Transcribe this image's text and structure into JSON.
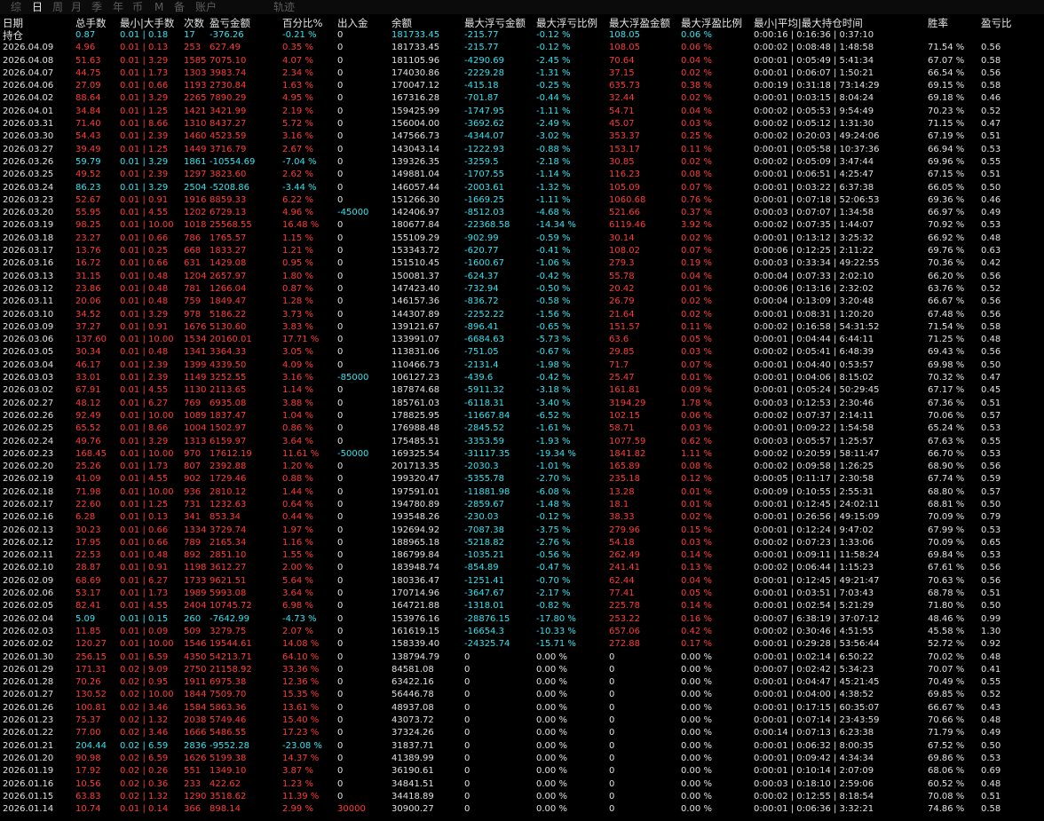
{
  "tabs": [
    "综",
    "日",
    "周",
    "月",
    "季",
    "年",
    "币",
    "M",
    "备",
    "账户",
    "轨迹"
  ],
  "active_tab": 1,
  "header": {
    "top": [
      "日期",
      "总手数",
      "最小|大手数",
      "次数",
      "盈亏金额",
      "百分比%",
      "出入金",
      "余额",
      "最大浮亏金额",
      "最大浮亏比例",
      "最大浮盈金额",
      "最大浮盈比例",
      "最小|平均|最大持仓时间",
      "胜率",
      "盈亏比"
    ],
    "second": "持仓",
    "position": [
      "0.87",
      "0.01 | 0.18",
      "17",
      "-376.26",
      "-0.21 %",
      "0",
      "181733.45",
      "-215.77",
      "-0.12 %",
      "108.05",
      "0.06 %",
      "0:00:16 | 0:16:36 | 0:37:10"
    ]
  },
  "colors": {
    "profit": "#ff3a3a",
    "loss": "#2fe4f0",
    "text": "#e0e0e0",
    "background": "#000000"
  },
  "rows": [
    "2026.04.09|4.96|0.01 | 0.13|253|627.49|0.35 %|0|181733.45|-215.77|-0.12 %|108.05|0.06 %|0:00:02 | 0:08:48 | 1:48:58|71.54 %|0.56|r|",
    "2026.04.08|51.63|0.01 | 3.29|1585|7075.10|4.07 %|0|181105.96|-4290.69|-2.45 %|70.64|0.04 %|0:00:01 | 0:05:49 | 5:41:34|67.07 %|0.58|r|",
    "2026.04.07|44.75|0.01 | 1.73|1303|3983.74|2.34 %|0|174030.86|-2229.28|-1.31 %|37.15|0.02 %|0:00:01 | 0:06:07 | 1:50:21|66.54 %|0.56|r|",
    "2026.04.06|27.09|0.01 | 0.66|1193|2730.84|1.63 %|0|170047.12|-415.18|-0.25 %|635.73|0.38 %|0:00:19 | 0:31:18 | 73:14:29|69.15 %|0.58|r|",
    "2026.04.02|88.64|0.01 | 3.29|2265|7890.29|4.95 %|0|167316.28|-701.87|-0.44 %|32.44|0.02 %|0:00:01 | 0:03:15 | 8:04:24|69.18 %|0.46|r|",
    "2026.04.01|34.84|0.01 | 1.25|1421|3421.99|2.19 %|0|159425.99|-1747.95|-1.11 %|54.71|0.04 %|0:00:02 | 0:05:53 | 9:54:49|70.23 %|0.52|r|",
    "2026.03.31|71.40|0.01 | 8.66|1310|8437.27|5.72 %|0|156004.00|-3692.62|-2.49 %|45.07|0.03 %|0:00:02 | 0:05:12 | 1:31:30|71.15 %|0.47|r|",
    "2026.03.30|54.43|0.01 | 2.39|1460|4523.59|3.16 %|0|147566.73|-4344.07|-3.02 %|353.37|0.25 %|0:00:02 | 0:20:03 | 49:24:06|67.19 %|0.51|r|",
    "2026.03.27|39.49|0.01 | 1.25|1449|3716.79|2.67 %|0|143043.14|-1222.93|-0.88 %|153.17|0.11 %|0:00:01 | 0:05:58 | 10:37:36|66.94 %|0.53|r|",
    "2026.03.26|59.79|0.01 | 3.29|1861|-10554.69|-7.04 %|0|139326.35|-3259.5|-2.18 %|30.85|0.02 %|0:00:02 | 0:05:09 | 3:47:44|69.96 %|0.55|g|",
    "2026.03.25|49.52|0.01 | 2.39|1297|3823.60|2.62 %|0|149881.04|-1707.55|-1.14 %|116.23|0.08 %|0:00:01 | 0:06:51 | 4:25:47|67.15 %|0.51|r|",
    "2026.03.24|86.23|0.01 | 3.29|2504|-5208.86|-3.44 %|0|146057.44|-2003.61|-1.32 %|105.09|0.07 %|0:00:01 | 0:03:22 | 6:37:38|66.05 %|0.50|g|",
    "2026.03.23|52.67|0.01 | 0.91|1916|8859.33|6.22 %|0|151266.30|-1669.25|-1.11 %|1060.68|0.76 %|0:00:01 | 0:07:18 | 52:06:53|69.36 %|0.46|r|",
    "2026.03.20|55.95|0.01 | 4.55|1202|6729.13|4.96 %|-45000|142406.97|-8512.03|-4.68 %|521.66|0.37 %|0:00:03 | 0:07:07 | 1:34:58|66.97 %|0.49|r|cy",
    "2026.03.19|98.25|0.01 | 10.00|1018|25568.55|16.48 %|0|180677.84|-22368.58|-14.34 %|6119.46|3.92 %|0:00:02 | 0:07:35 | 1:44:07|70.92 %|0.53|r|",
    "2026.03.18|23.27|0.01 | 0.66|786|1765.57|1.15 %|0|155109.29|-902.99|-0.59 %|30.14|0.02 %|0:00:01 | 0:13:12 | 3:25:32|66.92 %|0.48|r|",
    "2026.03.17|13.76|0.01 | 0.25|668|1833.27|1.21 %|0|153343.72|-620.77|-0.41 %|108.02|0.07 %|0:00:06 | 0:12:25 | 2:11:22|69.76 %|0.63|r|",
    "2026.03.16|16.72|0.01 | 0.66|631|1429.08|0.95 %|0|151510.45|-1600.67|-1.06 %|279.3|0.19 %|0:00:03 | 0:33:34 | 49:22:55|70.36 %|0.42|r|",
    "2026.03.13|31.15|0.01 | 0.48|1204|2657.97|1.80 %|0|150081.37|-624.37|-0.42 %|55.78|0.04 %|0:00:04 | 0:07:33 | 2:02:10|66.20 %|0.56|r|",
    "2026.03.12|23.86|0.01 | 0.48|781|1266.04|0.87 %|0|147423.40|-732.94|-0.50 %|20.42|0.01 %|0:00:06 | 0:13:16 | 2:32:02|63.76 %|0.52|r|",
    "2026.03.11|20.06|0.01 | 0.48|759|1849.47|1.28 %|0|146157.36|-836.72|-0.58 %|26.79|0.02 %|0:00:04 | 0:13:09 | 3:20:48|66.67 %|0.56|r|",
    "2026.03.10|34.52|0.01 | 3.29|978|5186.22|3.73 %|0|144307.89|-2252.22|-1.56 %|21.64|0.02 %|0:00:01 | 0:08:31 | 1:20:20|67.48 %|0.56|r|",
    "2026.03.09|37.27|0.01 | 0.91|1676|5130.60|3.83 %|0|139121.67|-896.41|-0.65 %|151.57|0.11 %|0:00:02 | 0:16:58 | 54:31:52|71.54 %|0.58|r|",
    "2026.03.06|137.60|0.01 | 10.00|1534|20160.01|17.71 %|0|133991.07|-6684.63|-5.73 %|63.6|0.05 %|0:00:01 | 0:04:44 | 6:44:11|71.25 %|0.48|r|",
    "2026.03.05|30.34|0.01 | 0.48|1341|3364.33|3.05 %|0|113831.06|-751.05|-0.67 %|29.85|0.03 %|0:00:02 | 0:05:41 | 6:48:39|69.43 %|0.56|r|",
    "2026.03.04|46.17|0.01 | 2.39|1399|4339.50|4.09 %|0|110466.73|-2131.4|-1.98 %|71.7|0.07 %|0:00:01 | 0:04:40 | 0:53:57|69.98 %|0.50|r|",
    "2026.03.03|33.01|0.01 | 2.39|1149|3252.55|3.16 %|-85000|106127.23|-439.6|-0.42 %|25.47|0.01 %|0:00:01 | 0:04:06 | 8:15:02|70.32 %|0.47|r|cy",
    "2026.03.02|67.91|0.01 | 4.55|1130|2113.65|1.14 %|0|187874.68|-5911.32|-3.18 %|161.81|0.09 %|0:00:01 | 0:05:24 | 50:29:45|67.17 %|0.45|r|",
    "2026.02.27|48.12|0.01 | 6.27|769|6935.08|3.88 %|0|185761.03|-6118.31|-3.40 %|3194.29|1.78 %|0:00:03 | 0:12:53 | 2:30:46|67.36 %|0.51|r|",
    "2026.02.26|92.49|0.01 | 10.00|1089|1837.47|1.04 %|0|178825.95|-11667.84|-6.52 %|102.15|0.06 %|0:00:02 | 0:07:37 | 2:14:11|70.06 %|0.57|r|",
    "2026.02.25|65.52|0.01 | 8.66|1004|1502.97|0.86 %|0|176988.48|-2845.52|-1.61 %|58.71|0.03 %|0:00:01 | 0:09:22 | 1:54:58|65.24 %|0.53|r|",
    "2026.02.24|49.76|0.01 | 3.29|1313|6159.97|3.64 %|0|175485.51|-3353.59|-1.93 %|1077.59|0.62 %|0:00:03 | 0:05:57 | 1:25:57|67.63 %|0.55|r|",
    "2026.02.23|168.45|0.01 | 10.00|970|17612.19|11.61 %|-50000|169325.54|-31117.35|-19.34 %|1841.82|1.11 %|0:00:02 | 0:20:59 | 58:11:47|66.70 %|0.53|r|cy",
    "2026.02.20|25.26|0.01 | 1.73|807|2392.88|1.20 %|0|201713.35|-2030.3|-1.01 %|165.89|0.08 %|0:00:02 | 0:09:58 | 1:26:25|68.90 %|0.56|r|",
    "2026.02.19|41.09|0.01 | 4.55|902|1729.46|0.88 %|0|199320.47|-5355.78|-2.70 %|235.18|0.12 %|0:00:05 | 0:11:17 | 2:30:58|67.74 %|0.59|r|",
    "2026.02.18|71.98|0.01 | 10.00|936|2810.12|1.44 %|0|197591.01|-11881.98|-6.08 %|13.28|0.01 %|0:00:09 | 0:10:55 | 2:55:31|68.80 %|0.57|r|",
    "2026.02.17|22.60|0.01 | 1.25|731|1232.63|0.64 %|0|194780.89|-2859.67|-1.48 %|18.1|0.01 %|0:00:01 | 0:12:45 | 24:02:11|68.81 %|0.50|r|",
    "2026.02.16|6.28|0.01 | 0.13|341|853.34|0.44 %|0|193548.26|-230.03|-0.12 %|38.33|0.02 %|0:00:01 | 0:26:56 | 49:15:09|70.09 %|0.79|r|",
    "2026.02.13|30.23|0.01 | 0.66|1334|3729.74|1.97 %|0|192694.92|-7087.38|-3.75 %|279.96|0.15 %|0:00:01 | 0:12:24 | 9:47:02|67.99 %|0.53|r|",
    "2026.02.12|17.95|0.01 | 0.66|789|2165.34|1.16 %|0|188965.18|-5218.82|-2.76 %|54.18|0.03 %|0:00:02 | 0:07:23 | 1:33:06|70.09 %|0.65|r|",
    "2026.02.11|22.53|0.01 | 0.48|892|2851.10|1.55 %|0|186799.84|-1035.21|-0.56 %|262.49|0.14 %|0:00:01 | 0:09:11 | 11:58:24|69.84 %|0.53|r|",
    "2026.02.10|28.87|0.01 | 0.91|1198|3612.27|2.00 %|0|183948.74|-854.89|-0.47 %|241.41|0.13 %|0:00:02 | 0:06:44 | 1:15:23|67.61 %|0.56|r|",
    "2026.02.09|68.69|0.01 | 6.27|1733|9621.51|5.64 %|0|180336.47|-1251.41|-0.70 %|62.44|0.04 %|0:00:01 | 0:12:45 | 49:21:47|70.63 %|0.56|r|",
    "2026.02.06|53.17|0.01 | 1.73|1989|5993.08|3.64 %|0|170714.96|-3647.67|-2.17 %|77.41|0.05 %|0:00:01 | 0:03:51 | 7:03:43|68.78 %|0.51|r|",
    "2026.02.05|82.41|0.01 | 4.55|2404|10745.72|6.98 %|0|164721.88|-1318.01|-0.82 %|225.78|0.14 %|0:00:01 | 0:02:54 | 5:21:29|71.80 %|0.50|r|",
    "2026.02.04|5.09|0.01 | 0.15|260|-7642.99|-4.73 %|0|153976.16|-28876.15|-17.80 %|253.22|0.16 %|0:00:07 | 6:38:19 | 37:07:12|48.46 %|0.99|g|",
    "2026.02.03|11.85|0.01 | 0.09|509|3279.75|2.07 %|0|161619.15|-16654.3|-10.33 %|657.06|0.42 %|0:00:02 | 0:30:46 | 4:51:55|45.58 %|1.30|r|",
    "2026.02.02|120.27|0.01 | 10.00|1546|19544.61|14.08 %|0|158339.40|-24325.74|-15.71 %|272.88|0.17 %|0:00:01 | 0:29:28 | 53:56:44|52.72 %|0.92|r|",
    "2026.01.30|256.15|0.01 | 6.59|4350|54213.71|64.10 %|0|138794.79|0|0.00 %|0|0.00 %|0:00:01 | 0:02:14 | 6:50:22|70.02 %|0.48|r|",
    "2026.01.29|171.31|0.02 | 9.09|2750|21158.92|33.36 %|0|84581.08|0|0.00 %|0|0.00 %|0:00:07 | 0:02:42 | 5:34:23|70.07 %|0.41|r|",
    "2026.01.28|70.26|0.02 | 0.95|1911|6975.38|12.36 %|0|63422.16|0|0.00 %|0|0.00 %|0:00:01 | 0:04:47 | 45:21:45|70.49 %|0.55|r|",
    "2026.01.27|130.52|0.02 | 10.00|1844|7509.70|15.35 %|0|56446.78|0|0.00 %|0|0.00 %|0:00:01 | 0:04:00 | 4:38:52|69.85 %|0.52|r|",
    "2026.01.26|100.81|0.02 | 3.46|1584|5863.36|13.61 %|0|48937.08|0|0.00 %|0|0.00 %|0:00:01 | 0:17:15 | 60:35:07|66.67 %|0.43|r|",
    "2026.01.23|75.37|0.02 | 1.32|2038|5749.46|15.40 %|0|43073.72|0|0.00 %|0|0.00 %|0:00:01 | 0:07:14 | 23:43:59|70.66 %|0.48|r|",
    "2026.01.22|77.00|0.02 | 3.46|1666|5486.55|17.23 %|0|37324.26|0|0.00 %|0|0.00 %|0:00:14 | 0:07:13 | 6:23:38|71.79 %|0.49|r|",
    "2026.01.21|204.44|0.02 | 6.59|2836|-9552.28|-23.08 %|0|31837.71|0|0.00 %|0|0.00 %|0:00:01 | 0:06:32 | 8:00:35|67.52 %|0.50|g|",
    "2026.01.20|90.98|0.02 | 6.59|1626|5199.38|14.37 %|0|41389.99|0|0.00 %|0|0.00 %|0:00:01 | 0:09:42 | 4:34:34|69.86 %|0.53|r|",
    "2026.01.19|17.92|0.02 | 0.26|551|1349.10|3.87 %|0|36190.61|0|0.00 %|0|0.00 %|0:00:01 | 0:10:14 | 2:07:09|68.06 %|0.69|r|",
    "2026.01.16|10.56|0.02 | 0.36|233|422.62|1.23 %|0|34841.51|0|0.00 %|0|0.00 %|0:00:03 | 0:18:10 | 2:59:06|60.52 %|0.48|r|",
    "2026.01.15|63.83|0.02 | 1.32|1290|3518.62|11.39 %|0|34418.89|0|0.00 %|0|0.00 %|0:00:02 | 0:12:55 | 8:18:54|70.08 %|0.51|r|",
    "2026.01.14|10.74|0.01 | 0.14|366|898.14|2.99 %|30000|30900.27|0|0.00 %|0|0.00 %|0:00:01 | 0:06:36 | 3:32:21|74.86 %|0.58|r|rd"
  ]
}
